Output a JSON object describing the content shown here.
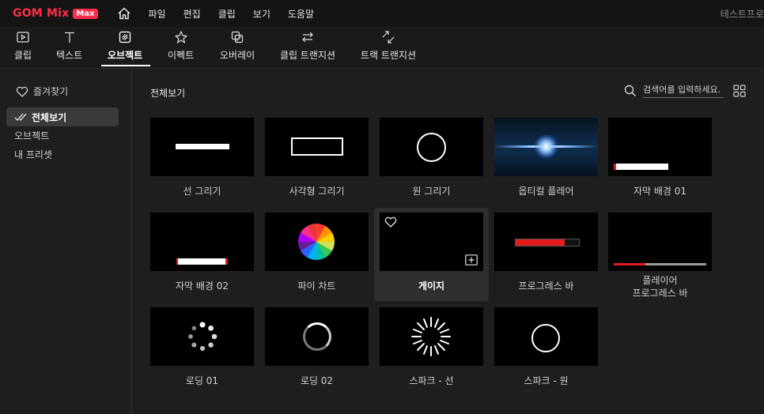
{
  "app": {
    "logo_text": "GOM Mix",
    "logo_badge": "Max",
    "project_name": "테스트프로"
  },
  "menu": [
    "파일",
    "편집",
    "클립",
    "보기",
    "도움말"
  ],
  "tools": [
    {
      "label": "클립",
      "icon": "clip-icon"
    },
    {
      "label": "텍스트",
      "icon": "text-icon"
    },
    {
      "label": "오브젝트",
      "icon": "object-icon"
    },
    {
      "label": "이펙트",
      "icon": "effect-icon"
    },
    {
      "label": "오버레이",
      "icon": "overlay-icon"
    },
    {
      "label": "클립 트랜지션",
      "icon": "clip-transition-icon"
    },
    {
      "label": "트랙 트랜지션",
      "icon": "track-transition-icon"
    }
  ],
  "active_tool": "오브젝트",
  "sidebar": {
    "favorites": "즐겨찾기",
    "items": [
      {
        "label": "전체보기",
        "active": true
      },
      {
        "label": "오브젝트",
        "active": false
      },
      {
        "label": "내 프리셋",
        "active": false
      }
    ]
  },
  "main": {
    "title": "전체보기",
    "search_placeholder": "검색어를 입력하세요."
  },
  "cards": [
    {
      "label": "선 그리기"
    },
    {
      "label": "사각형 그리기"
    },
    {
      "label": "원 그리기"
    },
    {
      "label": "옵티컬 플레어"
    },
    {
      "label": "자막 배경 01"
    },
    {
      "label": "자막 배경 02"
    },
    {
      "label": "파이 차트"
    },
    {
      "label": "게이지",
      "selected": true
    },
    {
      "label": "프로그레스 바"
    },
    {
      "label": "플레이어\n프로그레스 바"
    },
    {
      "label": "로딩 01"
    },
    {
      "label": "로딩 02"
    },
    {
      "label": "스파크 - 선"
    },
    {
      "label": "스파크 - 원"
    }
  ],
  "colors": {
    "accent": "#ff2d4b",
    "progress_red": "#e31b1b"
  }
}
